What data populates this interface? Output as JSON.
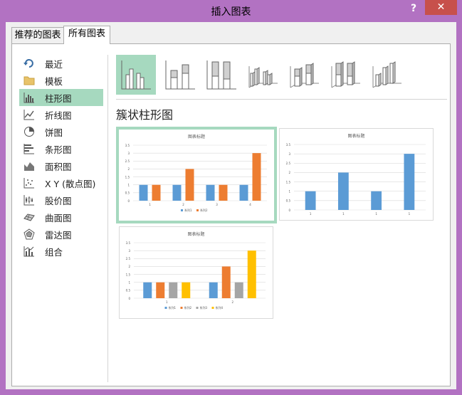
{
  "window": {
    "title": "插入图表",
    "help": "?",
    "close": "✕"
  },
  "tabs": {
    "recommended": "推荐的图表",
    "all": "所有图表"
  },
  "sidebar": {
    "items": [
      {
        "label": "最近",
        "icon": "recent-icon"
      },
      {
        "label": "模板",
        "icon": "folder-icon"
      },
      {
        "label": "柱形图",
        "icon": "column-chart-icon"
      },
      {
        "label": "折线图",
        "icon": "line-chart-icon"
      },
      {
        "label": "饼图",
        "icon": "pie-chart-icon"
      },
      {
        "label": "条形图",
        "icon": "bar-chart-icon"
      },
      {
        "label": "面积图",
        "icon": "area-chart-icon"
      },
      {
        "label": "X Y (散点图)",
        "icon": "scatter-chart-icon"
      },
      {
        "label": "股价图",
        "icon": "stock-chart-icon"
      },
      {
        "label": "曲面图",
        "icon": "surface-chart-icon"
      },
      {
        "label": "雷达图",
        "icon": "radar-chart-icon"
      },
      {
        "label": "组合",
        "icon": "combo-chart-icon"
      }
    ],
    "selected": "柱形图"
  },
  "subtypes": [
    "clustered-column",
    "stacked-column",
    "100-stacked-column",
    "3d-clustered-column",
    "3d-stacked-column",
    "3d-100-stacked-column",
    "3d-column"
  ],
  "section_title": "簇状柱形图",
  "colors": {
    "blue": "#5b9bd5",
    "orange": "#ed7d31",
    "gray": "#a5a5a5",
    "gold": "#ffc000",
    "selection": "#a6d9bf",
    "close": "#c7504b"
  },
  "chart_data": [
    {
      "type": "bar",
      "title": "图表标题",
      "categories": [
        "1",
        "2",
        "3",
        "4"
      ],
      "series": [
        {
          "name": "系列1",
          "values": [
            1,
            1,
            1,
            1
          ]
        },
        {
          "name": "系列2",
          "values": [
            1,
            2,
            1,
            3
          ]
        }
      ],
      "yticks": [
        "0",
        "0.5",
        "1",
        "1.5",
        "2",
        "2.5",
        "3",
        "3.5"
      ],
      "ylim": [
        0,
        3.5
      ],
      "legend": "bottom",
      "selected": true
    },
    {
      "type": "bar",
      "title": "图表标题",
      "categories": [
        "1",
        "1",
        "1",
        "1"
      ],
      "series": [
        {
          "values": [
            1,
            2,
            1,
            3
          ]
        }
      ],
      "yticks": [
        "0",
        "0.5",
        "1",
        "1.5",
        "2",
        "2.5",
        "3",
        "3.5"
      ],
      "ylim": [
        0,
        3.5
      ],
      "legend": "none"
    },
    {
      "type": "bar",
      "title": "图表标题",
      "categories": [
        "1",
        "2"
      ],
      "series": [
        {
          "name": "系列1",
          "values": [
            1,
            1
          ]
        },
        {
          "name": "系列2",
          "values": [
            1,
            2
          ]
        },
        {
          "name": "系列3",
          "values": [
            1,
            1
          ]
        },
        {
          "name": "系列4",
          "values": [
            1,
            3
          ]
        }
      ],
      "yticks": [
        "0",
        "0.5",
        "1",
        "1.5",
        "2",
        "2.5",
        "3",
        "3.5"
      ],
      "ylim": [
        0,
        3.5
      ],
      "legend": "bottom"
    }
  ]
}
